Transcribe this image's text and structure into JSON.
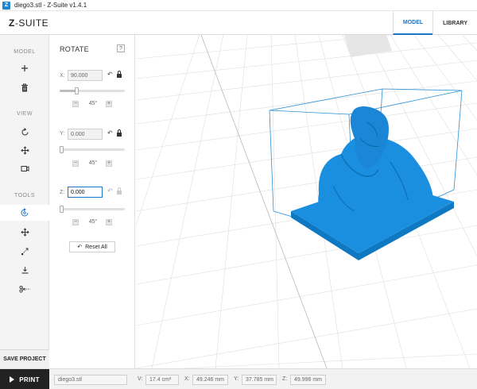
{
  "window": {
    "title": "diego3.stl - Z-Suite v1.4.1",
    "icon_letter": "Z"
  },
  "header": {
    "brand_bold": "Z",
    "brand_rest": "-SUITE",
    "tabs": [
      {
        "label": "MODEL",
        "active": true
      },
      {
        "label": "LIBRARY",
        "active": false
      }
    ]
  },
  "sidebar": {
    "model_title": "MODEL",
    "view_title": "VIEW",
    "tools_title": "TOOLS",
    "save_label": "SAVE PROJECT"
  },
  "rotate_panel": {
    "title": "ROTATE",
    "help": "?",
    "x": {
      "label": "X:",
      "value": "90.000",
      "step": "45°",
      "locked": true,
      "slider": 0.25
    },
    "y": {
      "label": "Y:",
      "value": "0.000",
      "step": "45°",
      "locked": true,
      "slider": 0.0
    },
    "z": {
      "label": "Z:",
      "value": "0.000",
      "step": "45°",
      "locked": false,
      "slider": 0.0
    },
    "reset_label": "Reset All"
  },
  "bottom": {
    "print_label": "PRINT",
    "filename": "diego3.stl",
    "v_label": "V:",
    "v_value": "17.4 cm³",
    "x_label": "X:",
    "x_value": "49.246 mm",
    "y_label": "Y:",
    "y_value": "37.785 mm",
    "z_label": "Z:",
    "z_value": "49.996 mm"
  },
  "colors": {
    "accent": "#1b74c6",
    "model": "#1a8fe0",
    "bbox": "#2a8fd8"
  }
}
